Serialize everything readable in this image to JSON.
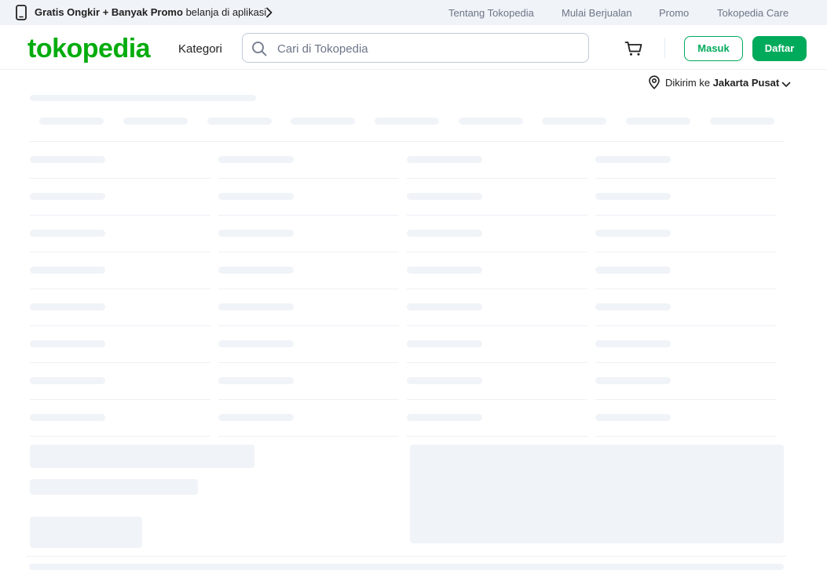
{
  "topbar": {
    "promo_bold": "Gratis Ongkir + Banyak Promo",
    "promo_text": "belanja di aplikasi",
    "links": [
      "Tentang Tokopedia",
      "Mulai Berjualan",
      "Promo",
      "Tokopedia Care"
    ]
  },
  "header": {
    "logo": "tokopedia",
    "kategori": "Kategori",
    "search_placeholder": "Cari di Tokopedia",
    "login_label": "Masuk",
    "register_label": "Daftar"
  },
  "location": {
    "prefix": "Dikirim ke",
    "city": "Jakarta Pusat"
  },
  "colors": {
    "brand": "#03ac0e",
    "button": "#00aa5b",
    "skeleton": "#f0f3f7"
  },
  "icons": [
    "phone-icon",
    "chevron-right-icon",
    "search-icon",
    "cart-icon",
    "location-pin-icon",
    "chevron-down-icon"
  ]
}
